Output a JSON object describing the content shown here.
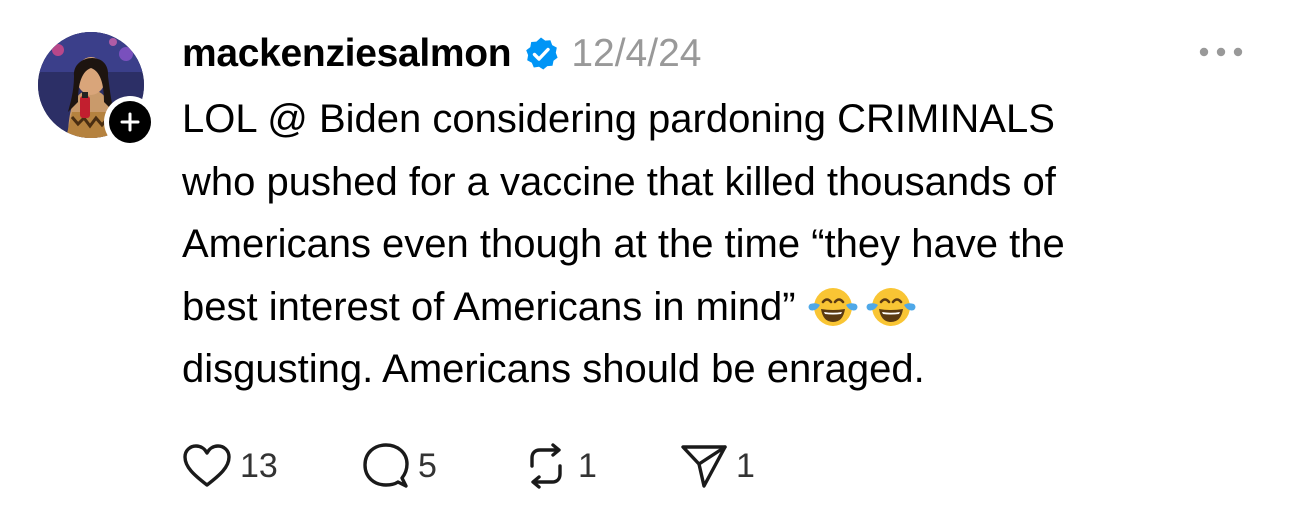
{
  "post": {
    "author": {
      "username": "mackenziesalmon",
      "verified": true,
      "avatar_icon": "profile-photo",
      "follow_icon": "plus-icon"
    },
    "date": "12/4/24",
    "more_icon": "ellipsis-icon",
    "text_lines": [
      "LOL @ Biden considering pardoning CRIMINALS",
      "who pushed for a vaccine that killed thousands of",
      "Americans even though at the time “they have the",
      "best interest of Americans in mind”",
      "disgusting. Americans should be enraged."
    ],
    "emoji": [
      "face-with-tears-of-joy",
      "face-with-tears-of-joy"
    ],
    "actions": {
      "like": {
        "icon": "heart-icon",
        "count": "13"
      },
      "reply": {
        "icon": "comment-icon",
        "count": "5"
      },
      "repost": {
        "icon": "repost-icon",
        "count": "1"
      },
      "share": {
        "icon": "send-icon",
        "count": "1"
      }
    }
  },
  "colors": {
    "text": "#000000",
    "secondary": "#999999",
    "verified_blue": "#0095f6",
    "count": "#333333"
  }
}
